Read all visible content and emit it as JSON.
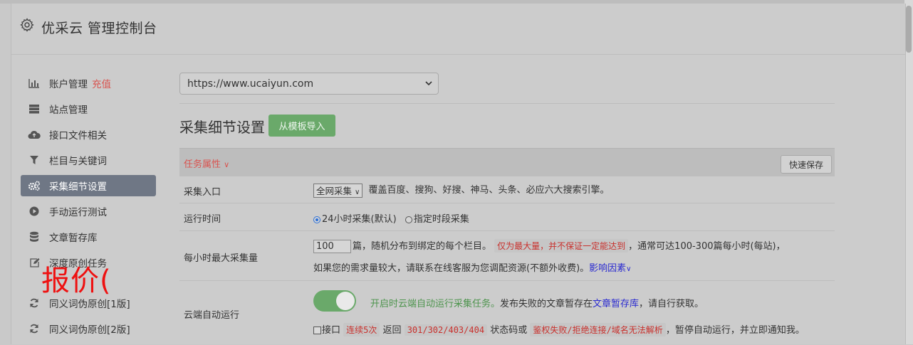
{
  "header": {
    "title": "优采云 管理控制台"
  },
  "sidebar": {
    "items": [
      {
        "label": "账户管理",
        "extra": "充值",
        "icon": "bar-chart-icon"
      },
      {
        "label": "站点管理",
        "icon": "server-icon"
      },
      {
        "label": "接口文件相关",
        "icon": "cloud-upload-icon"
      },
      {
        "label": "栏目与关键词",
        "icon": "filter-icon"
      },
      {
        "label": "采集细节设置",
        "icon": "cogs-icon",
        "active": true
      },
      {
        "label": "手动运行测试",
        "icon": "play-circle-icon"
      },
      {
        "label": "文章暂存库",
        "icon": "database-icon"
      },
      {
        "label": "深度原创任务",
        "icon": "edit-icon"
      },
      {
        "label": "同义词伪原创[1版]",
        "icon": "refresh-icon"
      },
      {
        "label": "同义词伪原创[2版]",
        "icon": "refresh-icon"
      }
    ]
  },
  "overlay": {
    "text": "报价("
  },
  "main": {
    "site_select": "https://www.ucaiyun.com",
    "section_title": "采集细节设置",
    "import_button": "从模板导入",
    "table_header": {
      "task_attr": "任务属性",
      "quick_save": "快速保存"
    },
    "rows": {
      "entry": {
        "label": "采集入口",
        "select": "全网采集",
        "desc": "覆盖百度、搜狗、好搜、神马、头条、必应六大搜索引擎。"
      },
      "runtime": {
        "label": "运行时间",
        "opt1": "24小时采集(默认)",
        "opt2": "指定时段采集"
      },
      "maxrate": {
        "label": "每小时最大采集量",
        "input": "100",
        "t1": "篇，随机分布到绑定的每个栏目。",
        "mark": "仅为最大量，并不保证一定能达到",
        "t2": "，通常可达100-300篇每小时(每站)，",
        "line2": "如果您的需求量较大，请联系在线客服为您调配资源(不额外收费)。",
        "link": "影响因素"
      },
      "cloud": {
        "label": "云端自动运行",
        "green": "开启时云端自动运行采集任务。",
        "t1": "发布失败的文章暂存在",
        "link": "文章暂存库",
        "t2": "，请自行获取。",
        "cb_label": "接口",
        "mark1": "连续5次",
        "t3": "返回",
        "mark2": "301/302/403/404",
        "t4": "状态码或",
        "mark3": "鉴权失败/拒绝连接/域名无法解析",
        "t5": "，暂停自动运行，并立即通知我。"
      }
    }
  }
}
